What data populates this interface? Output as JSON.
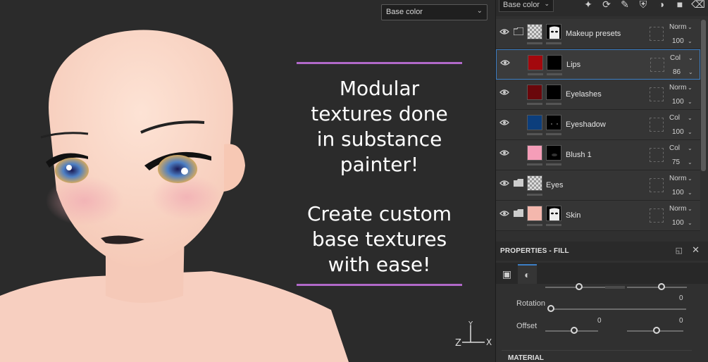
{
  "viewport": {
    "channel_select": "Base color",
    "promo_line1": [
      "Modular",
      "textures done",
      "in substance",
      "painter!"
    ],
    "promo_line2": [
      "Create custom",
      "base textures",
      "with ease!"
    ],
    "gizmo": {
      "x": "X",
      "y": "Y",
      "z": "Z"
    }
  },
  "layer_panel": {
    "channel_select": "Base color",
    "tools": [
      "paint-tool-icon",
      "smudge-icon",
      "brush-icon",
      "fill-icon",
      "mask-icon",
      "folder-icon",
      "trash-icon"
    ],
    "layers": [
      {
        "name": "Makeup presets",
        "blend": "Norm",
        "opacity": "100",
        "type": "folder",
        "thumb": "checker"
      },
      {
        "name": "Lips",
        "blend": "Col",
        "opacity": "86",
        "type": "fill",
        "thumb_color": "#a3080d",
        "selected": true
      },
      {
        "name": "Eyelashes",
        "blend": "Norm",
        "opacity": "100",
        "type": "fill",
        "thumb_color": "#6a070b"
      },
      {
        "name": "Eyeshadow",
        "blend": "Col",
        "opacity": "100",
        "type": "fill",
        "thumb_color": "#0c3e7c"
      },
      {
        "name": "Blush 1",
        "blend": "Col",
        "opacity": "75",
        "type": "fill",
        "thumb_color": "#f59db8"
      },
      {
        "name": "Eyes",
        "blend": "Norm",
        "opacity": "100",
        "type": "folder",
        "thumb": "checker"
      },
      {
        "name": "Skin",
        "blend": "Norm",
        "opacity": "100",
        "type": "folder",
        "thumb": "skin"
      }
    ]
  },
  "properties": {
    "title": "PROPERTIES - FILL",
    "rotation_label": "Rotation",
    "rotation_value": "0",
    "offset_label": "Offset",
    "offset_x_value": "0",
    "offset_y_value": "0",
    "material_label": "MATERIAL"
  },
  "colors": {
    "accent": "#b169c9",
    "selection": "#3c7ec4"
  }
}
